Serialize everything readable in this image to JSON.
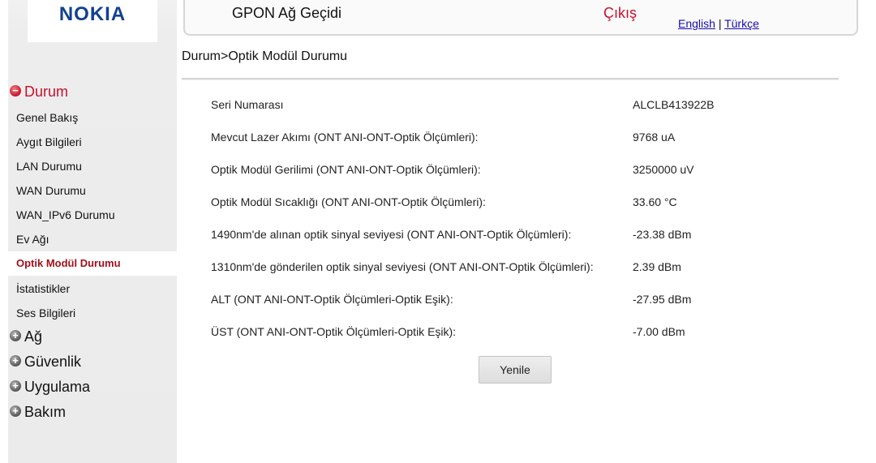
{
  "brand": {
    "logo_text": "NOKIA",
    "color": "#124191"
  },
  "header": {
    "title": "GPON Ağ Geçidi",
    "logout_label": "Çıkış",
    "lang_english": "English",
    "lang_separator": "|",
    "lang_turkish": "Türkçe"
  },
  "sidebar": {
    "sections": [
      {
        "label": "Durum",
        "icon": "minus-circle-icon",
        "expanded": true
      },
      {
        "label": "Ağ",
        "icon": "plus-circle-icon",
        "expanded": false
      },
      {
        "label": "Güvenlik",
        "icon": "plus-circle-icon",
        "expanded": false
      },
      {
        "label": "Uygulama",
        "icon": "plus-circle-icon",
        "expanded": false
      },
      {
        "label": "Bakım",
        "icon": "plus-circle-icon",
        "expanded": false
      }
    ],
    "items": [
      {
        "label": "Genel Bakış"
      },
      {
        "label": "Aygıt Bilgileri"
      },
      {
        "label": "LAN Durumu"
      },
      {
        "label": "WAN Durumu"
      },
      {
        "label": "WAN_IPv6 Durumu"
      },
      {
        "label": "Ev Ağı"
      },
      {
        "label": "Optik Modül Durumu",
        "active": true
      },
      {
        "label": "İstatistikler"
      },
      {
        "label": "Ses Bilgileri"
      }
    ]
  },
  "breadcrumb": "Durum>Optik Modül Durumu",
  "rows": [
    {
      "label": "Seri Numarası",
      "value": "ALCLB413922B"
    },
    {
      "label": "Mevcut Lazer Akımı (ONT ANI-ONT-Optik Ölçümleri):",
      "value": "9768 uA"
    },
    {
      "label": "Optik Modül Gerilimi (ONT ANI-ONT-Optik Ölçümleri):",
      "value": "3250000 uV"
    },
    {
      "label": "Optik Modül Sıcaklığı (ONT ANI-ONT-Optik Ölçümleri):",
      "value": "33.60 °C"
    },
    {
      "label": "1490nm'de alınan optik sinyal seviyesi (ONT ANI-ONT-Optik Ölçümleri):",
      "value": "-23.38 dBm"
    },
    {
      "label": "1310nm'de gönderilen optik sinyal seviyesi (ONT ANI-ONT-Optik Ölçümleri):",
      "value": "2.39 dBm"
    },
    {
      "label": "ALT (ONT ANI-ONT-Optik Ölçümleri-Optik Eşik):",
      "value": "-27.95 dBm"
    },
    {
      "label": "ÜST (ONT ANI-ONT-Optik Ölçümleri-Optik Eşik):",
      "value": "-7.00 dBm"
    }
  ],
  "refresh_label": "Yenile",
  "colors": {
    "accent_red": "#c8102e",
    "active_item": "#a0101d"
  }
}
